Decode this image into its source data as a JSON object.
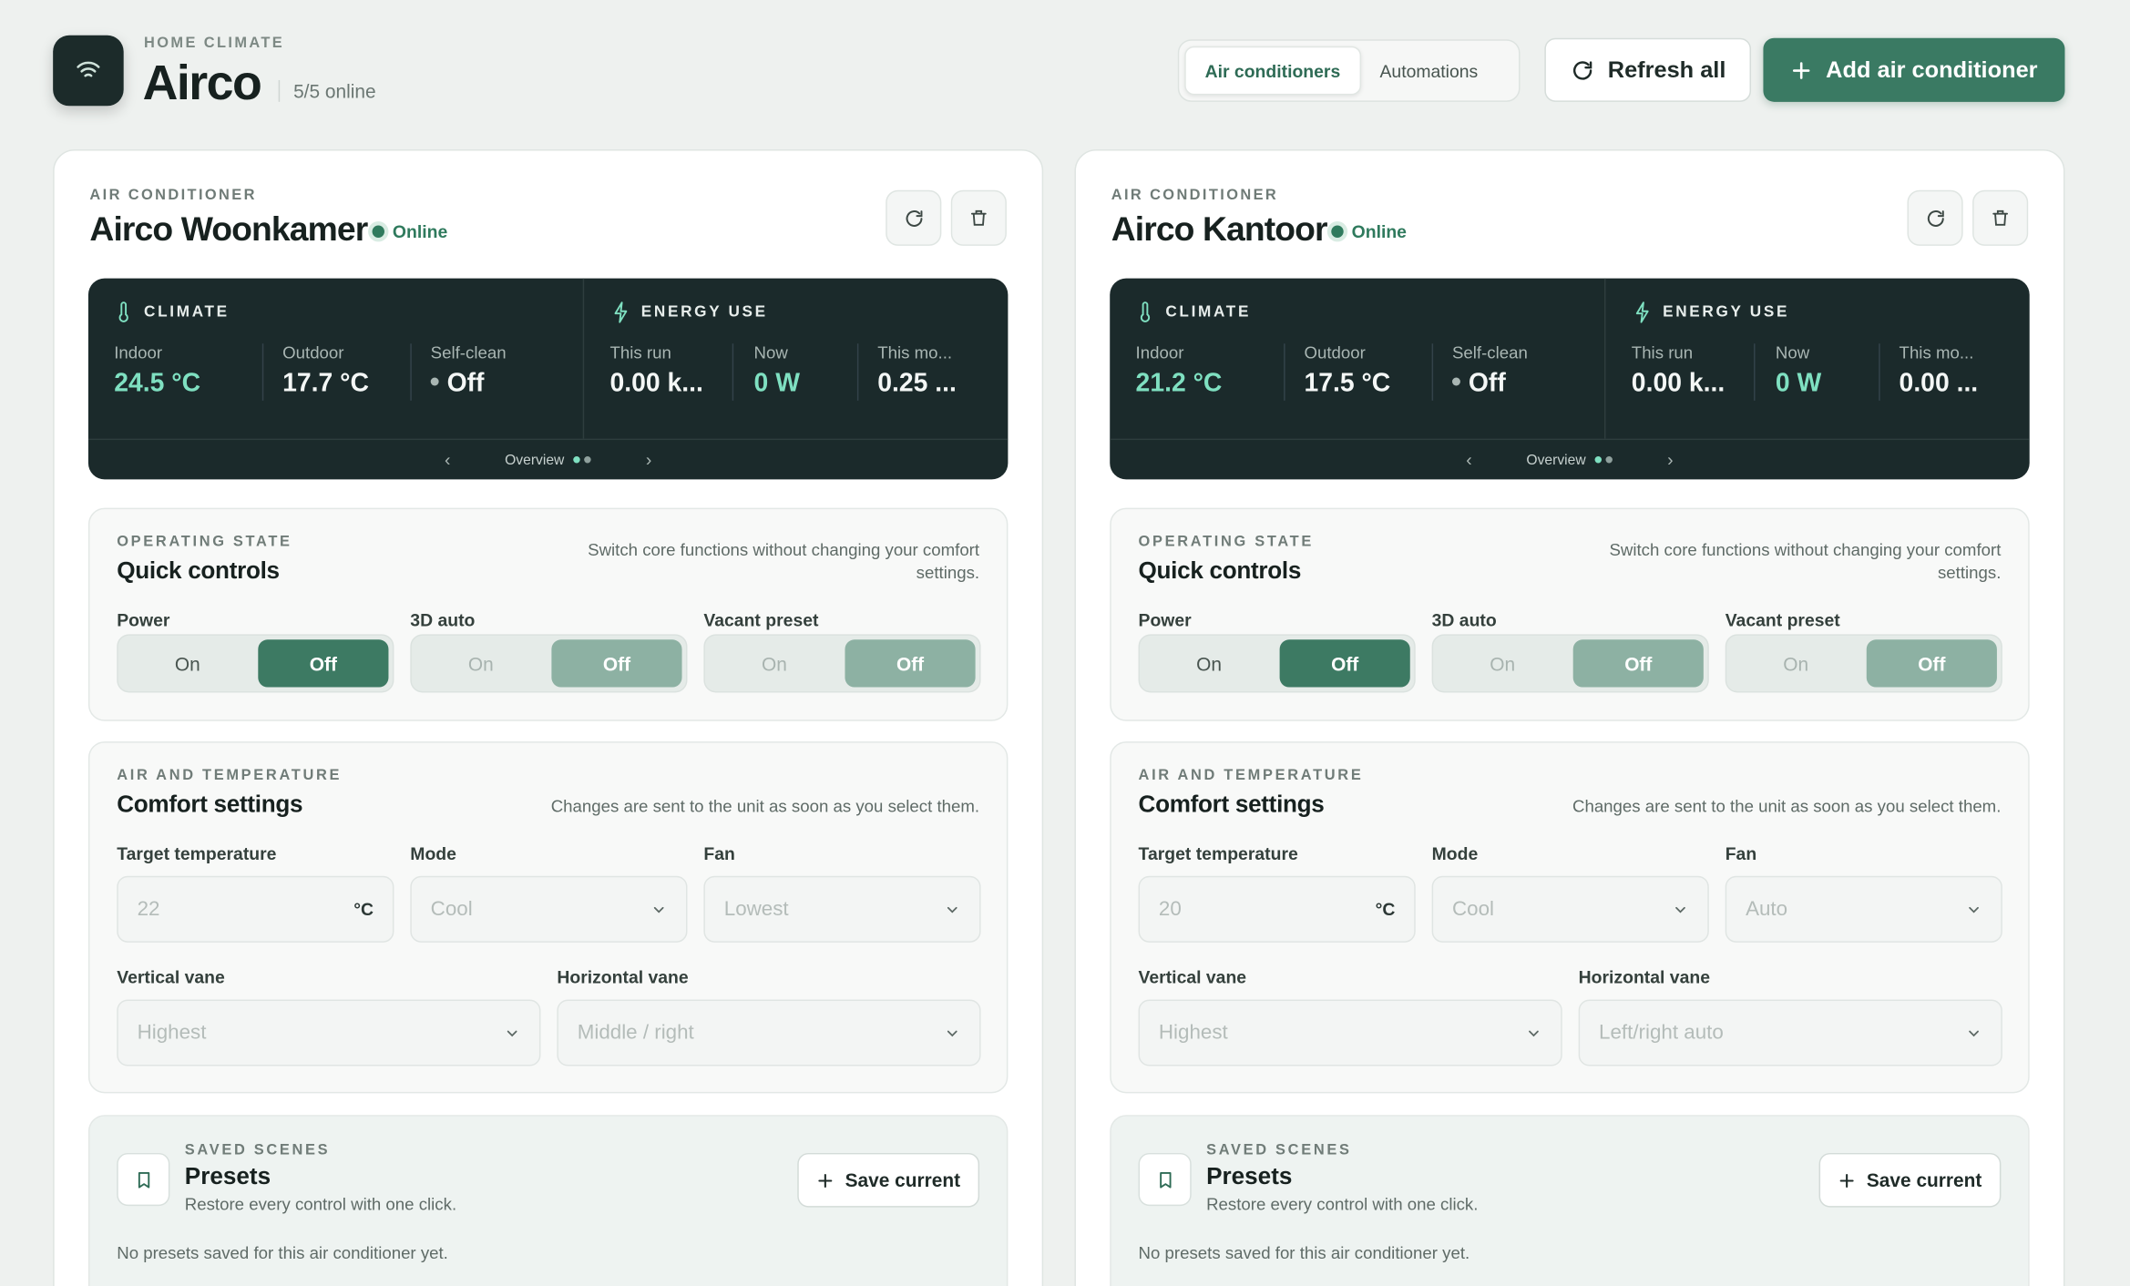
{
  "header": {
    "eyebrow": "HOME CLIMATE",
    "title": "Airco",
    "online": "5/5 online",
    "tabs": [
      {
        "label": "Air conditioners",
        "active": true
      },
      {
        "label": "Automations",
        "active": false
      }
    ],
    "refresh_label": "Refresh all",
    "add_label": "Add air conditioner"
  },
  "colors": {
    "accent": "#3a7a63",
    "dark_panel": "#1b2a2b",
    "accent_value": "#7fe0c1",
    "online": "#2f7a5d"
  },
  "units": [
    {
      "eyebrow": "AIR CONDITIONER",
      "name": "Airco Woonkamer",
      "status": "Online",
      "climate": {
        "title": "CLIMATE",
        "indoor_label": "Indoor",
        "indoor": "24.5 °C",
        "outdoor_label": "Outdoor",
        "outdoor": "17.7 °C",
        "selfclean_label": "Self-clean",
        "selfclean": "Off"
      },
      "energy": {
        "title": "ENERGY USE",
        "run_label": "This run",
        "run": "0.00 k...",
        "now_label": "Now",
        "now": "0 W",
        "month_label": "This mo...",
        "month": "0.25 ..."
      },
      "overview_label": "Overview",
      "quick": {
        "eyebrow": "OPERATING STATE",
        "title": "Quick controls",
        "note": "Switch core functions without changing your comfort settings.",
        "power_label": "Power",
        "auto3d_label": "3D auto",
        "vacant_label": "Vacant preset",
        "on_label": "On",
        "off_label": "Off"
      },
      "comfort": {
        "eyebrow": "AIR AND TEMPERATURE",
        "title": "Comfort settings",
        "note": "Changes are sent to the unit as soon as you select them.",
        "target_label": "Target temperature",
        "target": "22",
        "target_unit": "°C",
        "mode_label": "Mode",
        "mode": "Cool",
        "fan_label": "Fan",
        "fan": "Lowest",
        "vvane_label": "Vertical vane",
        "vvane": "Highest",
        "hvane_label": "Horizontal vane",
        "hvane": "Middle / right"
      },
      "presets": {
        "eyebrow": "SAVED SCENES",
        "title": "Presets",
        "subtitle": "Restore every control with one click.",
        "save_label": "Save current",
        "empty": "No presets saved for this air conditioner yet."
      }
    },
    {
      "eyebrow": "AIR CONDITIONER",
      "name": "Airco Kantoor",
      "status": "Online",
      "climate": {
        "title": "CLIMATE",
        "indoor_label": "Indoor",
        "indoor": "21.2 °C",
        "outdoor_label": "Outdoor",
        "outdoor": "17.5 °C",
        "selfclean_label": "Self-clean",
        "selfclean": "Off"
      },
      "energy": {
        "title": "ENERGY USE",
        "run_label": "This run",
        "run": "0.00 k...",
        "now_label": "Now",
        "now": "0 W",
        "month_label": "This mo...",
        "month": "0.00 ..."
      },
      "overview_label": "Overview",
      "quick": {
        "eyebrow": "OPERATING STATE",
        "title": "Quick controls",
        "note": "Switch core functions without changing your comfort settings.",
        "power_label": "Power",
        "auto3d_label": "3D auto",
        "vacant_label": "Vacant preset",
        "on_label": "On",
        "off_label": "Off"
      },
      "comfort": {
        "eyebrow": "AIR AND TEMPERATURE",
        "title": "Comfort settings",
        "note": "Changes are sent to the unit as soon as you select them.",
        "target_label": "Target temperature",
        "target": "20",
        "target_unit": "°C",
        "mode_label": "Mode",
        "mode": "Cool",
        "fan_label": "Fan",
        "fan": "Auto",
        "vvane_label": "Vertical vane",
        "vvane": "Highest",
        "hvane_label": "Horizontal vane",
        "hvane": "Left/right auto"
      },
      "presets": {
        "eyebrow": "SAVED SCENES",
        "title": "Presets",
        "subtitle": "Restore every control with one click.",
        "save_label": "Save current",
        "empty": "No presets saved for this air conditioner yet."
      }
    }
  ]
}
